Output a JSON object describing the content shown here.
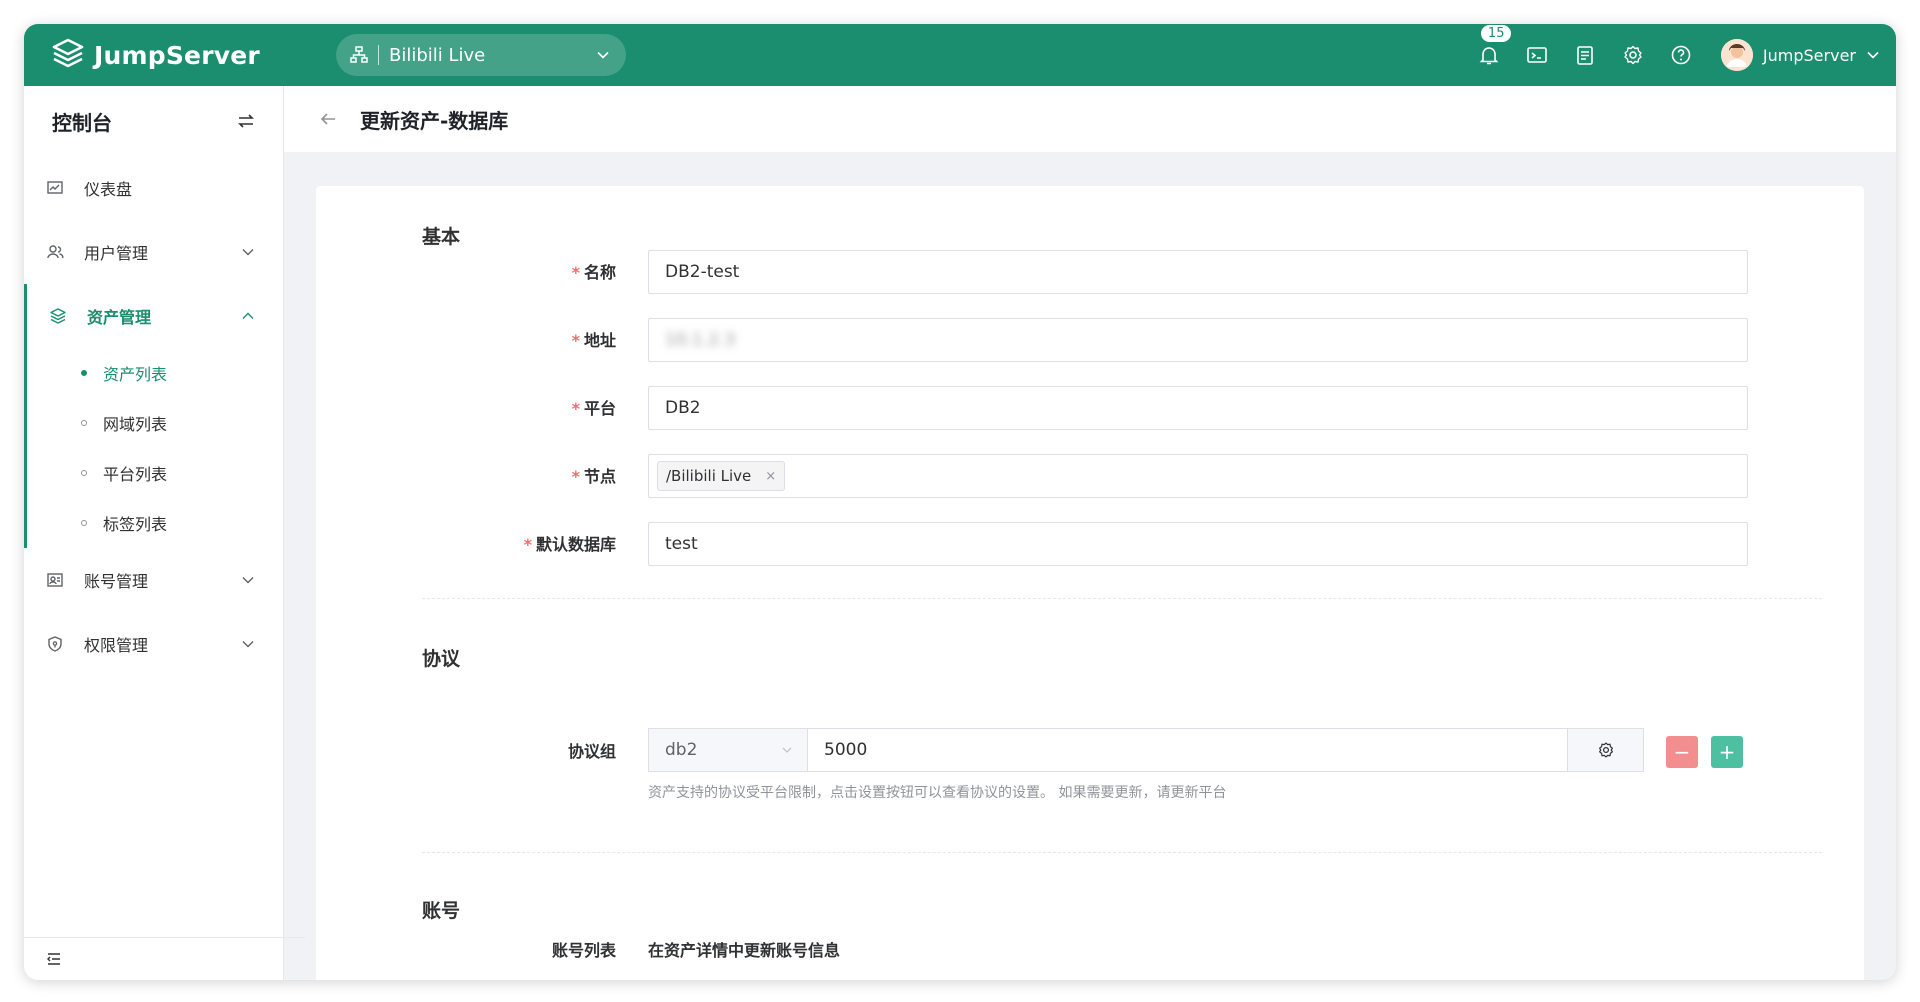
{
  "header": {
    "brand": "JumpServer",
    "org": "Bilibili Live",
    "notification_count": "15",
    "user_name": "JumpServer",
    "icons": [
      "bell-icon",
      "terminal-icon",
      "ticket-icon",
      "settings-icon",
      "help-icon"
    ]
  },
  "sidebar": {
    "title": "控制台",
    "items": [
      {
        "label": "仪表盘"
      },
      {
        "label": "用户管理"
      },
      {
        "label": "资产管理"
      },
      {
        "label": "账号管理"
      },
      {
        "label": "权限管理"
      }
    ],
    "asset_sub": [
      {
        "label": "资产列表"
      },
      {
        "label": "网域列表"
      },
      {
        "label": "平台列表"
      },
      {
        "label": "标签列表"
      }
    ]
  },
  "page": {
    "title": "更新资产-数据库"
  },
  "form": {
    "basic_title": "基本",
    "fields": {
      "name": {
        "label": "名称",
        "value": "DB2-test"
      },
      "address": {
        "label": "地址",
        "value": "10.1.2.3"
      },
      "platform": {
        "label": "平台",
        "value": "DB2"
      },
      "nodes": {
        "label": "节点",
        "tag": "/Bilibili Live",
        "tag_remove": "×"
      },
      "default_db": {
        "label": "默认数据库",
        "value": "test"
      }
    },
    "protocol_title": "协议",
    "protocol": {
      "label": "协议组",
      "name": "db2",
      "port": "5000",
      "minus": "−",
      "plus": "+",
      "help": "资产支持的协议受平台限制，点击设置按钮可以查看协议的设置。 如果需要更新，请更新平台"
    },
    "account_title": "账号",
    "accounts": {
      "label": "账号列表",
      "text": "在资产详情中更新账号信息"
    }
  },
  "colors": {
    "brand": "#1a8e6e",
    "required": "#f56c6c",
    "minus": "#f38e8e",
    "plus": "#4cc0a0"
  }
}
